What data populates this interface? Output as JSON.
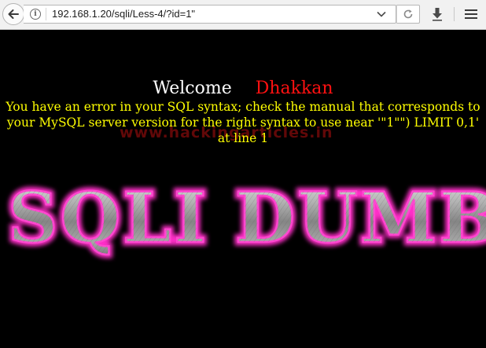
{
  "browser": {
    "url": "192.168.1.20/sqli/Less-4/?id=1\"",
    "icons": {
      "back": "back-arrow-icon",
      "info": "info-icon",
      "dropdown": "chevron-down-icon",
      "reload": "reload-icon",
      "download": "download-icon",
      "menu": "hamburger-menu-icon"
    }
  },
  "page": {
    "welcome_word": "Welcome",
    "welcome_name": "Dhakkan",
    "error_message": "You have an error in your SQL syntax; check the manual that corresponds to your MySQL server version for the right syntax to use near '\"1\"\") LIMIT 0,1' at line 1",
    "watermark": "www.hackingarticles.in",
    "banner_text": "SQLI DUMB SERIES"
  },
  "colors": {
    "background": "#000000",
    "welcome": "#ffffff",
    "name": "#ff1111",
    "error": "#ffff00",
    "banner_glow": "#ff2ec8",
    "watermark": "#7a0a0a"
  }
}
